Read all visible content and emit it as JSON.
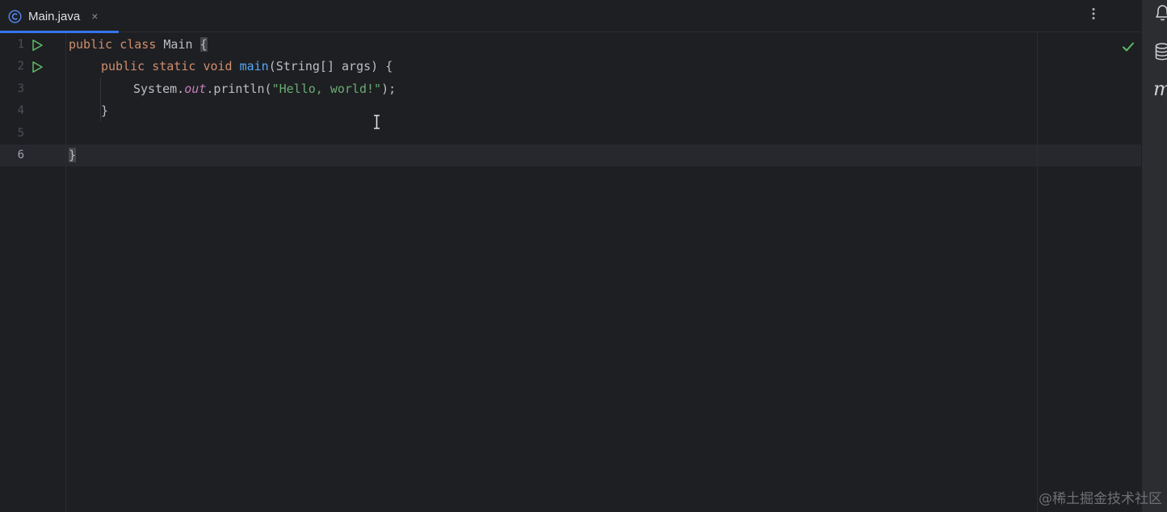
{
  "tab": {
    "label": "Main.java",
    "close_glyph": "×",
    "icon": "java-class-icon"
  },
  "toolbar": {
    "more_icon": "more-vertical-icon"
  },
  "editor": {
    "line_numbers": [
      "1",
      "2",
      "3",
      "4",
      "5",
      "6"
    ],
    "current_line": "6",
    "lines": {
      "l1": {
        "kw1": "public",
        "kw2": "class",
        "name": "Main",
        "brace": "{"
      },
      "l2": {
        "kw1": "public",
        "kw2": "static",
        "kw3": "void",
        "method": "main",
        "rest": "(String[] args) {"
      },
      "l3": {
        "prefix": "System.",
        "field": "out",
        "mid": ".println(",
        "string": "\"Hello, world!\"",
        "suffix": ");"
      },
      "l4": {
        "text": "}"
      },
      "l6": {
        "text": "}"
      }
    },
    "inspection_status": "no-problems-check-icon"
  },
  "right_strip": {
    "icons": [
      "notifications-bell-icon",
      "database-icon",
      "maven-icon"
    ],
    "maven_glyph": "m"
  },
  "watermark": "@稀土掘金技术社区",
  "colors": {
    "background": "#1e1f22",
    "keyword": "#cf8e6d",
    "method": "#56a8f5",
    "string": "#6aab73",
    "static_field": "#c77dbb",
    "accent": "#3574f0",
    "run_icon": "#5fb865"
  }
}
